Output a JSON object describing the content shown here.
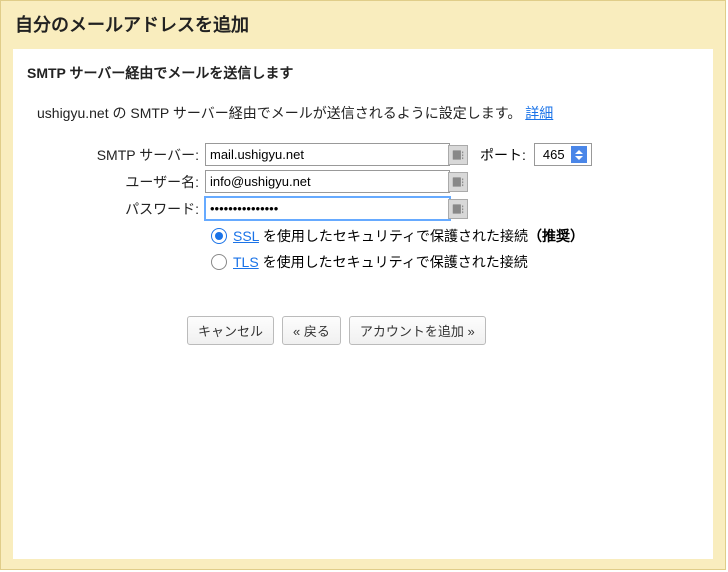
{
  "title": "自分のメールアドレスを追加",
  "subtitle": "SMTP サーバー経由でメールを送信します",
  "description_prefix": "ushigyu.net の SMTP サーバー経由でメールが送信されるように設定します。",
  "description_link": "詳細",
  "form": {
    "smtp_label": "SMTP サーバー:",
    "smtp_value": "mail.ushigyu.net",
    "port_label": "ポート:",
    "port_value": "465",
    "user_label": "ユーザー名:",
    "user_value": "info@ushigyu.net",
    "password_label": "パスワード:",
    "password_value": "•••••••••••••••"
  },
  "security": {
    "ssl_link": "SSL",
    "ssl_text": " を使用したセキュリティで保護された接続",
    "ssl_recommended": "（推奨）",
    "tls_link": "TLS",
    "tls_text": " を使用したセキュリティで保護された接続"
  },
  "buttons": {
    "cancel": "キャンセル",
    "back": "« 戻る",
    "add": "アカウントを追加 »"
  }
}
